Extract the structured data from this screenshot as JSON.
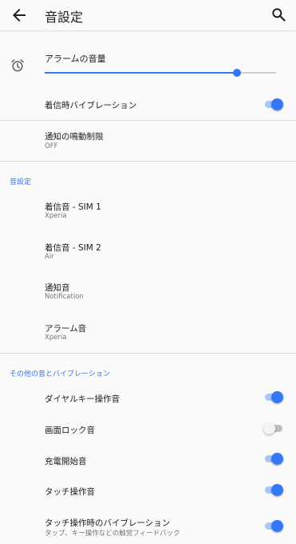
{
  "header": {
    "title": "音設定",
    "back_icon": "arrow-back-icon",
    "search_icon": "search-icon"
  },
  "volume": {
    "icon": "alarm-clock-icon",
    "label": "アラームの音量",
    "level": 0.83
  },
  "vibrate_on_ring": {
    "label": "着信時バイブレーション",
    "enabled": true
  },
  "notification_limit": {
    "label": "通知の鳴動制限",
    "value": "OFF"
  },
  "sound_section": {
    "header": "音設定",
    "items": [
      {
        "title": "着信音 - SIM 1",
        "subtitle": "Xperia"
      },
      {
        "title": "着信音 - SIM 2",
        "subtitle": "Air"
      },
      {
        "title": "通知音",
        "subtitle": "Notification"
      },
      {
        "title": "アラーム音",
        "subtitle": "Xperia"
      }
    ]
  },
  "other_section": {
    "header": "その他の音とバイブレーション",
    "items": [
      {
        "title": "ダイヤルキー操作音",
        "enabled": true
      },
      {
        "title": "画面ロック音",
        "enabled": false
      },
      {
        "title": "充電開始音",
        "enabled": true
      },
      {
        "title": "タッチ操作音",
        "enabled": true
      },
      {
        "title": "タッチ操作時のバイブレーション",
        "subtitle": "タップ、キー操作などの触覚フィードバック",
        "enabled": true
      }
    ]
  },
  "colors": {
    "accent": "#3478f6",
    "accent_track": "#a9c6fb",
    "background": "#fafafa"
  }
}
